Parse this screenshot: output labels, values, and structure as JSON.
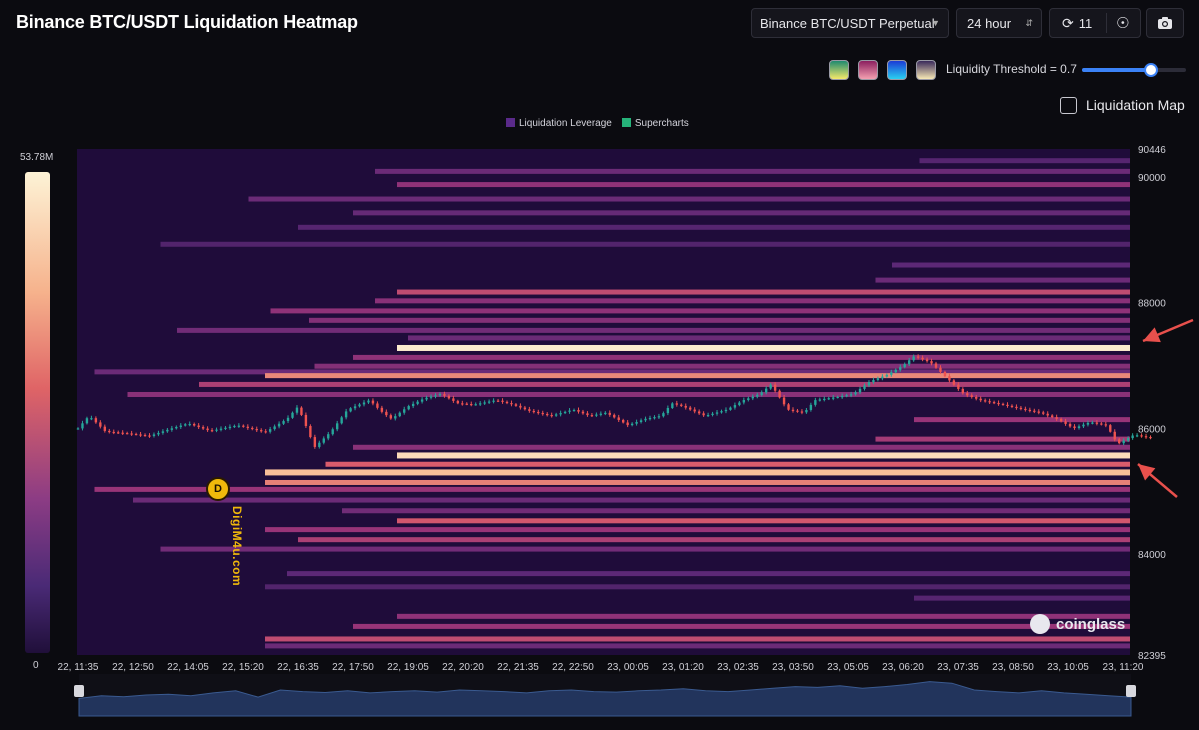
{
  "header": {
    "title": "Binance BTC/USDT Liquidation Heatmap",
    "exchange_value": "Binance BTC/USDT Perpetual",
    "period_value": "24 hour",
    "refresh_count": "11"
  },
  "controls": {
    "palette_swatches": [
      {
        "name": "green-palette",
        "gradient": [
          "#1f8a6f",
          "#f5e96a"
        ]
      },
      {
        "name": "magenta-palette",
        "gradient": [
          "#8b1f5f",
          "#f4a0b0"
        ]
      },
      {
        "name": "blue-palette",
        "gradient": [
          "#1b3bd6",
          "#2ad0f0"
        ]
      },
      {
        "name": "cream-palette",
        "gradient": [
          "#3a2a5a",
          "#f7e8b4"
        ]
      }
    ],
    "threshold_label": "Liquidity Threshold = 0.7",
    "threshold_value": 0.7,
    "liquidation_map_label": "Liquidation Map",
    "liquidation_map_checked": false
  },
  "colorbar": {
    "max_label": "53.78M",
    "min_label": "0"
  },
  "watermarks": {
    "left_text": "DigiM4u.com",
    "left_logo": "D",
    "right_text": "coinglass"
  },
  "colors": {
    "background": "#1f0c3a",
    "up_candle": "#26a69a",
    "down_candle": "#ef5350",
    "arrow": "#e8504c",
    "slider": "#3b82f6"
  },
  "chart_data": {
    "type": "heatmap",
    "legend": [
      {
        "name": "Liquidation Leverage",
        "color": "#5a2a8a"
      },
      {
        "name": "Supercharts",
        "color": "#26b37a"
      }
    ],
    "legend_position": "top-center",
    "ylim": [
      82395,
      90446
    ],
    "y_tick_labels": [
      "90446",
      "90000",
      "88000",
      "86000",
      "84000",
      "82395"
    ],
    "y_ticks": [
      90446,
      90000,
      88000,
      86000,
      84000,
      82395
    ],
    "x_tick_labels": [
      "22, 11:35",
      "22, 12:50",
      "22, 14:05",
      "22, 15:20",
      "22, 16:35",
      "22, 17:50",
      "22, 19:05",
      "22, 20:20",
      "22, 21:35",
      "22, 22:50",
      "23, 00:05",
      "23, 01:20",
      "23, 02:35",
      "23, 03:50",
      "23, 05:05",
      "23, 06:20",
      "23, 07:35",
      "23, 08:50",
      "23, 10:05",
      "23, 11:20"
    ],
    "bands": [
      {
        "price": 90260,
        "start": 15.3,
        "intensity": 0.22
      },
      {
        "price": 90090,
        "start": 5.4,
        "intensity": 0.3
      },
      {
        "price": 89880,
        "start": 5.8,
        "intensity": 0.42
      },
      {
        "price": 89650,
        "start": 3.1,
        "intensity": 0.3
      },
      {
        "price": 89430,
        "start": 5.0,
        "intensity": 0.28
      },
      {
        "price": 89200,
        "start": 4.0,
        "intensity": 0.22
      },
      {
        "price": 88930,
        "start": 1.5,
        "intensity": 0.2
      },
      {
        "price": 88600,
        "start": 14.8,
        "intensity": 0.25
      },
      {
        "price": 88360,
        "start": 14.5,
        "intensity": 0.3
      },
      {
        "price": 88170,
        "start": 5.8,
        "intensity": 0.55
      },
      {
        "price": 88030,
        "start": 5.4,
        "intensity": 0.4
      },
      {
        "price": 87870,
        "start": 3.5,
        "intensity": 0.42
      },
      {
        "price": 87720,
        "start": 4.2,
        "intensity": 0.38
      },
      {
        "price": 87560,
        "start": 1.8,
        "intensity": 0.32
      },
      {
        "price": 87440,
        "start": 6.0,
        "intensity": 0.3
      },
      {
        "price": 87280,
        "start": 5.8,
        "intensity": 0.98
      },
      {
        "price": 87130,
        "start": 5.0,
        "intensity": 0.42
      },
      {
        "price": 86990,
        "start": 4.3,
        "intensity": 0.38
      },
      {
        "price": 86900,
        "start": 0.3,
        "intensity": 0.3
      },
      {
        "price": 86840,
        "start": 3.4,
        "intensity": 0.72
      },
      {
        "price": 86700,
        "start": 2.2,
        "intensity": 0.5
      },
      {
        "price": 86540,
        "start": 0.9,
        "intensity": 0.4
      },
      {
        "price": 86140,
        "start": 15.2,
        "intensity": 0.45
      },
      {
        "price": 85830,
        "start": 14.5,
        "intensity": 0.48
      },
      {
        "price": 85700,
        "start": 5.0,
        "intensity": 0.4
      },
      {
        "price": 85570,
        "start": 5.8,
        "intensity": 0.93
      },
      {
        "price": 85430,
        "start": 4.5,
        "intensity": 0.62
      },
      {
        "price": 85300,
        "start": 3.4,
        "intensity": 0.85
      },
      {
        "price": 85140,
        "start": 3.4,
        "intensity": 0.7
      },
      {
        "price": 85030,
        "start": 0.3,
        "intensity": 0.45
      },
      {
        "price": 84860,
        "start": 1.0,
        "intensity": 0.3
      },
      {
        "price": 84690,
        "start": 4.8,
        "intensity": 0.32
      },
      {
        "price": 84530,
        "start": 5.8,
        "intensity": 0.6
      },
      {
        "price": 84390,
        "start": 3.4,
        "intensity": 0.45
      },
      {
        "price": 84230,
        "start": 4.0,
        "intensity": 0.5
      },
      {
        "price": 84080,
        "start": 1.5,
        "intensity": 0.32
      },
      {
        "price": 83690,
        "start": 3.8,
        "intensity": 0.25
      },
      {
        "price": 83480,
        "start": 3.4,
        "intensity": 0.2
      },
      {
        "price": 83300,
        "start": 15.2,
        "intensity": 0.22
      },
      {
        "price": 83010,
        "start": 5.8,
        "intensity": 0.42
      },
      {
        "price": 82850,
        "start": 5.0,
        "intensity": 0.45
      },
      {
        "price": 82650,
        "start": 3.4,
        "intensity": 0.55
      },
      {
        "price": 82540,
        "start": 3.4,
        "intensity": 0.3
      }
    ],
    "price_path": [
      [
        0,
        86000
      ],
      [
        0.2,
        86200
      ],
      [
        0.5,
        85950
      ],
      [
        0.9,
        85920
      ],
      [
        1.3,
        85880
      ],
      [
        1.7,
        86000
      ],
      [
        2.0,
        86080
      ],
      [
        2.4,
        85960
      ],
      [
        2.9,
        86050
      ],
      [
        3.4,
        85940
      ],
      [
        3.8,
        86150
      ],
      [
        4.0,
        86350
      ],
      [
        4.3,
        85700
      ],
      [
        4.6,
        85950
      ],
      [
        4.9,
        86300
      ],
      [
        5.3,
        86450
      ],
      [
        5.5,
        86280
      ],
      [
        5.7,
        86150
      ],
      [
        6.0,
        86350
      ],
      [
        6.3,
        86480
      ],
      [
        6.6,
        86550
      ],
      [
        6.9,
        86400
      ],
      [
        7.2,
        86380
      ],
      [
        7.6,
        86450
      ],
      [
        7.9,
        86380
      ],
      [
        8.2,
        86280
      ],
      [
        8.6,
        86200
      ],
      [
        9.0,
        86300
      ],
      [
        9.3,
        86200
      ],
      [
        9.6,
        86250
      ],
      [
        10.0,
        86050
      ],
      [
        10.3,
        86150
      ],
      [
        10.6,
        86200
      ],
      [
        10.8,
        86400
      ],
      [
        11.0,
        86350
      ],
      [
        11.4,
        86200
      ],
      [
        11.8,
        86300
      ],
      [
        12.1,
        86450
      ],
      [
        12.4,
        86550
      ],
      [
        12.6,
        86700
      ],
      [
        12.9,
        86300
      ],
      [
        13.2,
        86250
      ],
      [
        13.4,
        86450
      ],
      [
        13.8,
        86500
      ],
      [
        14.1,
        86550
      ],
      [
        14.4,
        86750
      ],
      [
        14.7,
        86850
      ],
      [
        15.0,
        87000
      ],
      [
        15.2,
        87150
      ],
      [
        15.5,
        87050
      ],
      [
        15.8,
        86800
      ],
      [
        16.1,
        86550
      ],
      [
        16.4,
        86450
      ],
      [
        16.8,
        86380
      ],
      [
        17.2,
        86300
      ],
      [
        17.5,
        86250
      ],
      [
        17.8,
        86150
      ],
      [
        18.1,
        86000
      ],
      [
        18.4,
        86100
      ],
      [
        18.7,
        86050
      ],
      [
        18.9,
        85750
      ],
      [
        19.2,
        85900
      ],
      [
        19.5,
        85850
      ]
    ],
    "volume_profile": [
      0.42,
      0.48,
      0.46,
      0.5,
      0.52,
      0.48,
      0.55,
      0.6,
      0.45,
      0.62,
      0.58,
      0.56,
      0.6,
      0.55,
      0.58,
      0.6,
      0.57,
      0.62,
      0.6,
      0.58,
      0.55,
      0.6,
      0.62,
      0.58,
      0.57,
      0.6,
      0.62,
      0.65,
      0.6,
      0.58,
      0.62,
      0.66,
      0.7,
      0.68,
      0.72,
      0.66,
      0.7,
      0.75,
      0.82,
      0.78,
      0.62,
      0.58,
      0.55,
      0.6,
      0.55,
      0.52,
      0.48,
      0.45
    ]
  }
}
